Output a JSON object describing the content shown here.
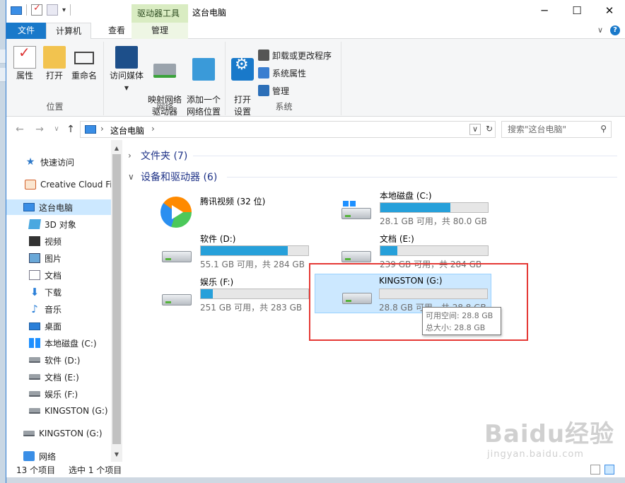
{
  "titlebar": {
    "contextual_tab_group": "驱动器工具",
    "window_title": "这台电脑",
    "minimize": "─",
    "maximize": "☐",
    "close": "✕"
  },
  "ribbon_tabs": {
    "file": "文件",
    "computer": "计算机",
    "view": "查看",
    "manage": "管理",
    "collapse_glyph": "∨",
    "help_glyph": "?"
  },
  "ribbon": {
    "groups": [
      {
        "label": "位置",
        "buttons": [
          "属性",
          "打开",
          "重命名"
        ]
      },
      {
        "label": "网络",
        "buttons": [
          "访问媒体",
          "映射网络\n驱动器",
          "添加一个\n网络位置"
        ]
      },
      {
        "label": "系统",
        "buttons": [
          "打开\n设置"
        ],
        "small_buttons": [
          "卸载或更改程序",
          "系统属性",
          "管理"
        ]
      }
    ]
  },
  "address": {
    "back": "←",
    "forward": "→",
    "recent": "∨",
    "up": "↑",
    "crumb_sep": "›",
    "crumb": "这台电脑",
    "end_sep": "›",
    "dropdown": "∨",
    "refresh": "↻",
    "search_placeholder": "搜索\"这台电脑\"",
    "search_icon": "⚲"
  },
  "nav_pane": {
    "items": [
      {
        "label": "快速访问",
        "icon": "star-icon"
      },
      {
        "label": "Creative Cloud Fi",
        "icon": "creative-cloud-icon"
      },
      {
        "label": "这台电脑",
        "icon": "computer-icon",
        "selected": true
      },
      {
        "label": "3D 对象",
        "icon": "3d-objects-icon"
      },
      {
        "label": "视频",
        "icon": "video-icon"
      },
      {
        "label": "图片",
        "icon": "pictures-icon"
      },
      {
        "label": "文档",
        "icon": "documents-icon"
      },
      {
        "label": "下载",
        "icon": "download-icon"
      },
      {
        "label": "音乐",
        "icon": "music-icon"
      },
      {
        "label": "桌面",
        "icon": "desktop-icon"
      },
      {
        "label": "本地磁盘 (C:)",
        "icon": "windows-drive-icon"
      },
      {
        "label": "软件 (D:)",
        "icon": "drive-icon"
      },
      {
        "label": "文档 (E:)",
        "icon": "drive-icon"
      },
      {
        "label": "娱乐 (F:)",
        "icon": "drive-icon"
      },
      {
        "label": "KINGSTON (G:)",
        "icon": "drive-icon"
      },
      {
        "label": "KINGSTON (G:)",
        "icon": "drive-icon"
      },
      {
        "label": "网络",
        "icon": "network-icon"
      }
    ],
    "scroll_up": "▲",
    "scroll_down": "▼"
  },
  "content": {
    "folders_header": "文件夹 (7)",
    "folders_chevron": "›",
    "devices_header": "设备和驱动器 (6)",
    "devices_chevron": "∨",
    "drives": [
      {
        "name": "腾讯视频 (32 位)",
        "icon": "tencent-video-icon",
        "bar": false
      },
      {
        "name": "本地磁盘 (C:)",
        "icon": "windows-drive-icon",
        "bar": true,
        "used_fraction": 0.65,
        "info": "28.1 GB 可用，共 80.0 GB"
      },
      {
        "name": "软件 (D:)",
        "icon": "drive-icon",
        "bar": true,
        "used_fraction": 0.81,
        "info": "55.1 GB 可用，共 284 GB"
      },
      {
        "name": "文档 (E:)",
        "icon": "drive-icon",
        "bar": true,
        "used_fraction": 0.16,
        "info": "239 GB 可用，共 284 GB"
      },
      {
        "name": "娱乐 (F:)",
        "icon": "drive-icon",
        "bar": true,
        "used_fraction": 0.11,
        "info": "251 GB 可用，共 283 GB"
      },
      {
        "name": "KINGSTON (G:)",
        "icon": "drive-icon",
        "bar": true,
        "used_fraction": 0.0,
        "info": "28.8 GB 可用，共 28.8 GB",
        "selected": true
      }
    ],
    "tooltip": {
      "free": "可用空间: 28.8 GB",
      "total": "总大小: 28.8 GB"
    }
  },
  "statusbar": {
    "count": "13 个项目",
    "selection": "选中 1 个项目"
  },
  "watermark": {
    "main": "Baidu经验",
    "url": "jingyan.baidu.com"
  },
  "colors": {
    "accent": "#1979ca",
    "progress": "#26a0da",
    "selection": "#cce8ff",
    "highlight_box": "#e53935"
  }
}
